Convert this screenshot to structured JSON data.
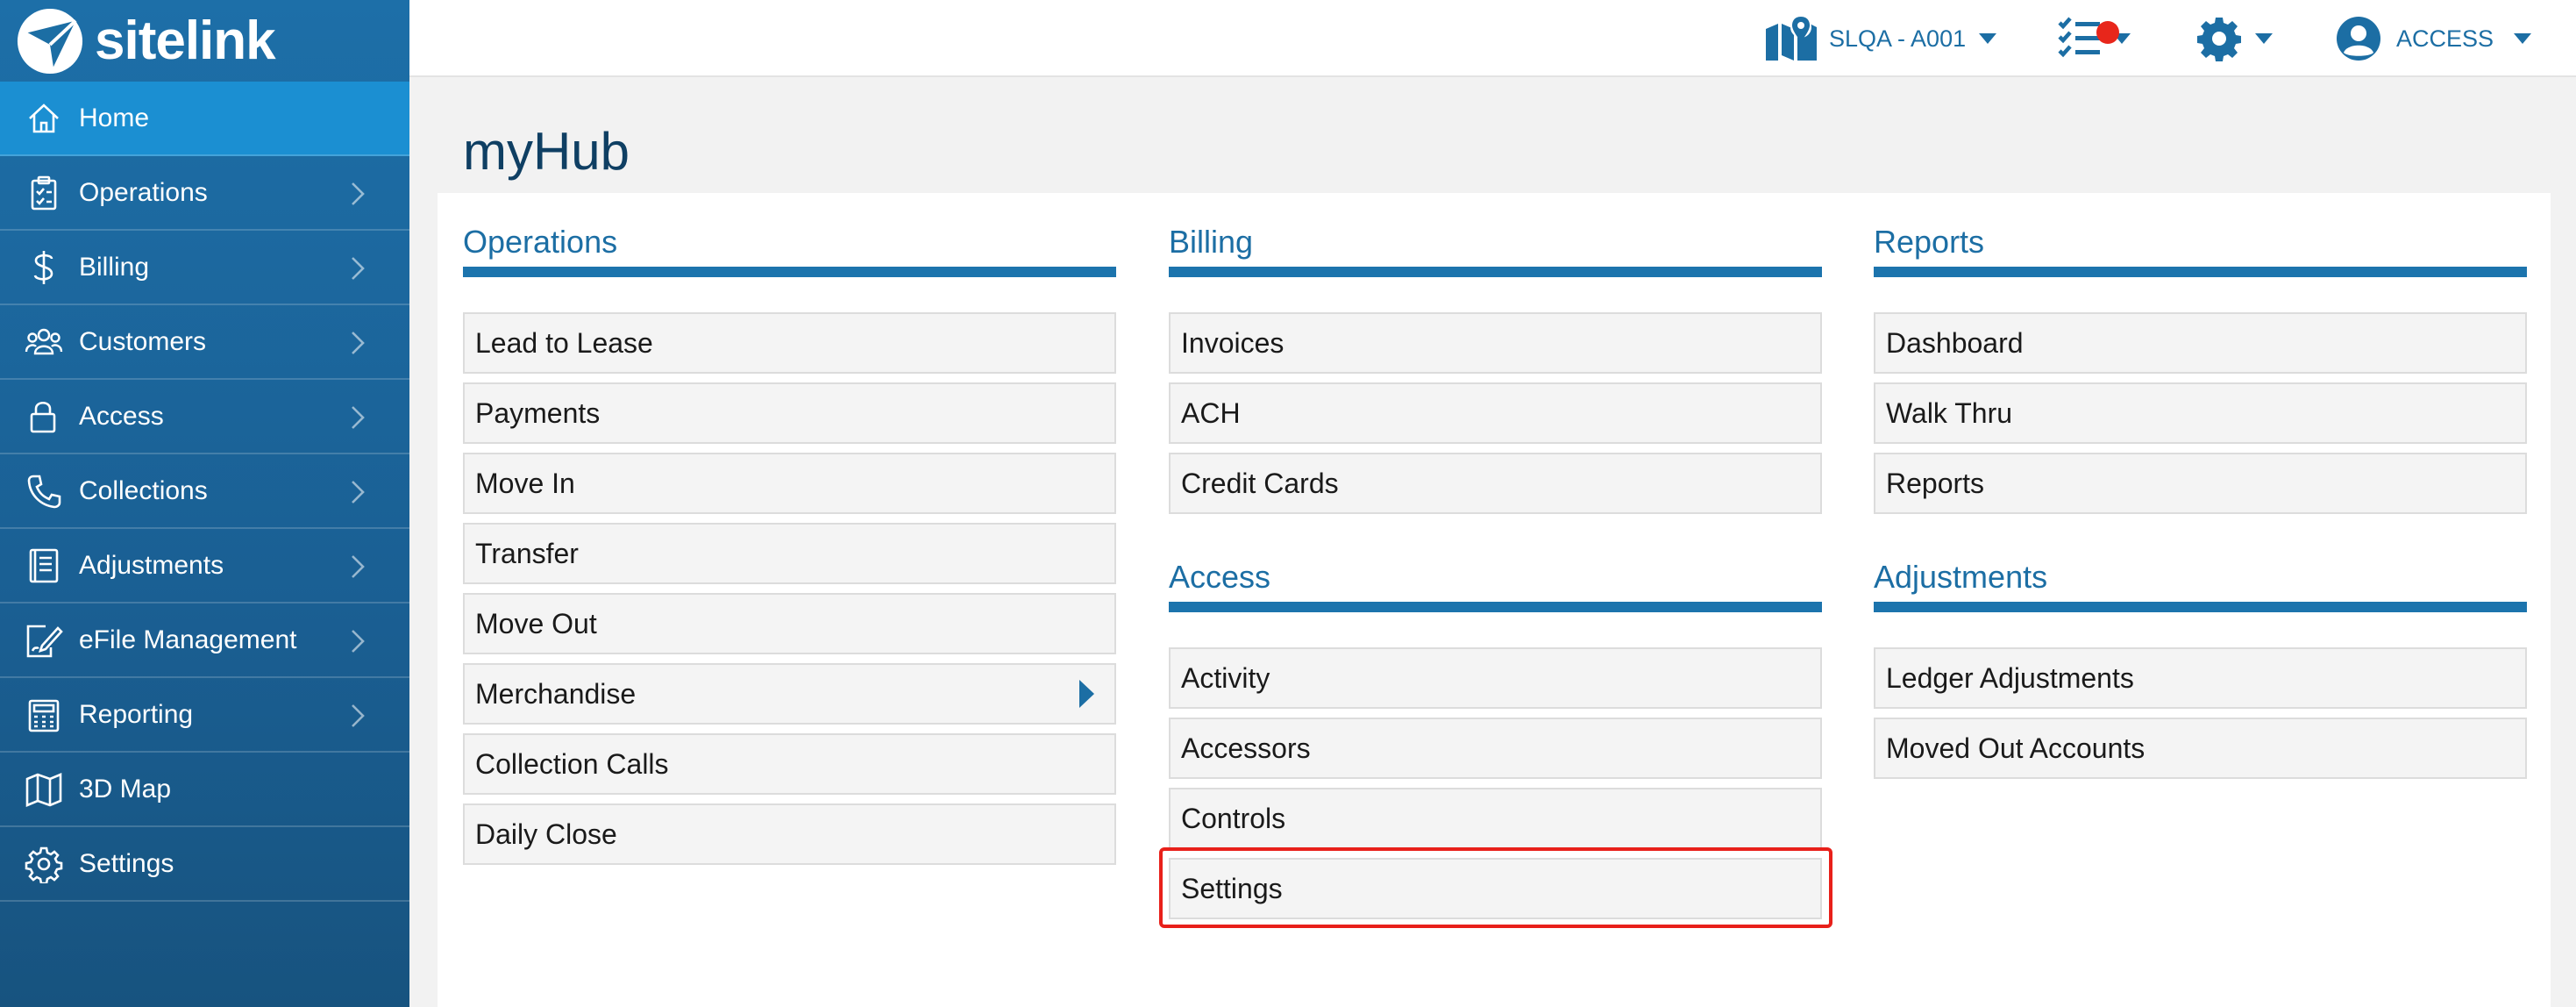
{
  "brand": {
    "name": "sitelink"
  },
  "sidebar": {
    "items": [
      {
        "label": "Home",
        "icon": "home-icon",
        "active": true,
        "chevron": false
      },
      {
        "label": "Operations",
        "icon": "clipboard-icon",
        "chevron": true
      },
      {
        "label": "Billing",
        "icon": "dollar-icon",
        "chevron": true
      },
      {
        "label": "Customers",
        "icon": "users-icon",
        "chevron": true
      },
      {
        "label": "Access",
        "icon": "lock-icon",
        "chevron": true
      },
      {
        "label": "Collections",
        "icon": "phone-icon",
        "chevron": true
      },
      {
        "label": "Adjustments",
        "icon": "ledger-icon",
        "chevron": true
      },
      {
        "label": "eFile Management",
        "icon": "file-edit-icon",
        "chevron": true
      },
      {
        "label": "Reporting",
        "icon": "calculator-icon",
        "chevron": true
      },
      {
        "label": "3D Map",
        "icon": "map-icon",
        "chevron": false
      },
      {
        "label": "Settings",
        "icon": "gear-icon",
        "chevron": false
      }
    ]
  },
  "topbar": {
    "location": {
      "label": "SLQA - A001",
      "icon": "location-map-icon"
    },
    "tasks": {
      "icon": "task-list-icon",
      "has_notification": true
    },
    "settings": {
      "icon": "gear-icon"
    },
    "user": {
      "label": "ACCESS",
      "icon": "user-circle-icon"
    }
  },
  "page": {
    "title": "myHub"
  },
  "sections": {
    "operations": {
      "title": "Operations",
      "items": [
        "Lead to Lease",
        "Payments",
        "Move In",
        "Transfer",
        "Move Out",
        "Merchandise",
        "Collection Calls",
        "Daily Close"
      ]
    },
    "billing": {
      "title": "Billing",
      "items": [
        "Invoices",
        "ACH",
        "Credit Cards"
      ]
    },
    "reports": {
      "title": "Reports",
      "items": [
        "Dashboard",
        "Walk Thru",
        "Reports"
      ]
    },
    "access": {
      "title": "Access",
      "items": [
        "Activity",
        "Accessors",
        "Controls",
        "Settings"
      ]
    },
    "adjustments": {
      "title": "Adjustments",
      "items": [
        "Ledger Adjustments",
        "Moved Out Accounts"
      ]
    }
  },
  "colors": {
    "sidebar": "#1a5f93",
    "active": "#1b8fd2",
    "accent": "#1c6ea4",
    "highlight": "#e8201a",
    "badge": "#e8261b"
  }
}
